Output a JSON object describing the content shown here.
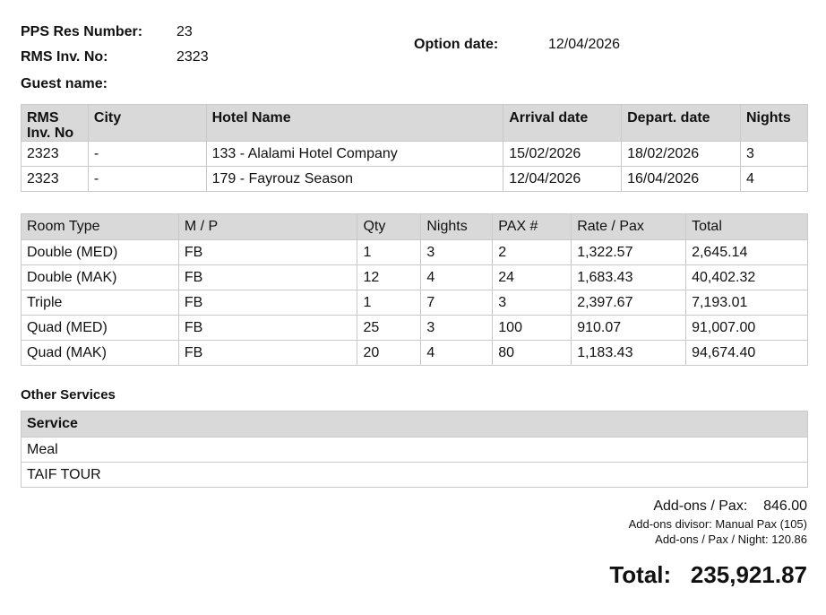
{
  "header": {
    "pps_res_label": "PPS Res Number:",
    "pps_res_value": "23",
    "rms_inv_label": "RMS Inv. No:",
    "rms_inv_value": "2323",
    "guest_label": "Guest name:",
    "option_label": "Option date:",
    "option_value": "12/04/2026"
  },
  "hotels": {
    "headers": [
      "RMS\nInv. No",
      "City",
      "Hotel Name",
      "Arrival date",
      "Depart. date",
      "Nights"
    ],
    "rows": [
      [
        "2323",
        "-",
        "133 - Alalami Hotel Company",
        "15/02/2026",
        "18/02/2026",
        "3"
      ],
      [
        "2323",
        "-",
        "179 - Fayrouz Season",
        "12/04/2026",
        "16/04/2026",
        "4"
      ]
    ]
  },
  "rooms": {
    "headers": [
      "Room Type",
      "M / P",
      "Qty",
      "Nights",
      "PAX #",
      "Rate / Pax",
      "Total"
    ],
    "rows": [
      [
        "Double (MED)",
        "FB",
        "1",
        "3",
        "2",
        "1,322.57",
        "2,645.14"
      ],
      [
        "Double (MAK)",
        "FB",
        "12",
        "4",
        "24",
        "1,683.43",
        "40,402.32"
      ],
      [
        "Triple",
        "FB",
        "1",
        "7",
        "3",
        "2,397.67",
        "7,193.01"
      ],
      [
        "Quad (MED)",
        "FB",
        "25",
        "3",
        "100",
        "910.07",
        "91,007.00"
      ],
      [
        "Quad (MAK)",
        "FB",
        "20",
        "4",
        "80",
        "1,183.43",
        "94,674.40"
      ]
    ]
  },
  "services": {
    "title": "Other Services",
    "header": "Service",
    "rows": [
      "Meal",
      "TAIF TOUR"
    ]
  },
  "summary": {
    "addons_label": "Add-ons / Pax:",
    "addons_value": "846.00",
    "divisor_text": "Add-ons divisor: Manual Pax (105)",
    "per_night_text": "Add-ons / Pax / Night: 120.86",
    "total_label": "Total:",
    "total_value": "235,921.87"
  }
}
